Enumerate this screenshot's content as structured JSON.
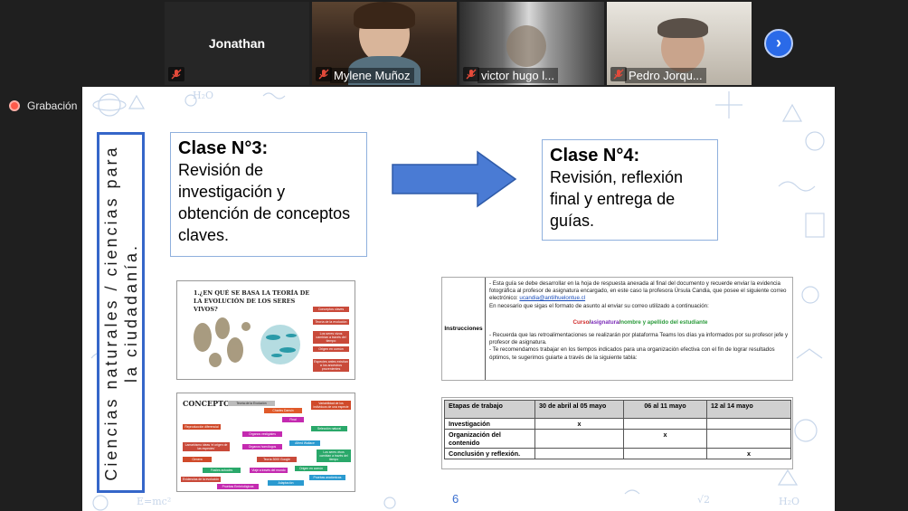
{
  "participants": [
    {
      "name": "Jonathan",
      "muted": true,
      "video": false
    },
    {
      "name": "Mylene Muñoz",
      "muted": true,
      "video": true
    },
    {
      "name": "victor hugo l...",
      "muted": true,
      "video": true
    },
    {
      "name": "Pedro Jorqu...",
      "muted": true,
      "video": true
    }
  ],
  "recording_label": "Grabación",
  "next_button": "›",
  "slide": {
    "vertical_title": "Ciencias naturales / ciencias para la ciudadanía.",
    "clase3_title": "Clase N°3:",
    "clase3_body": "Revisión de investigación y obtención de conceptos claves.",
    "clase4_title": "Clase N°4:",
    "clase4_body": "Revisión, reflexión final y entrega de guías.",
    "page_number": "6",
    "evo_question": "1.¿EN QUÉ SE BASA LA TEORÍA DE LA EVOLUCIÓN DE LOS SERES VIVOS?",
    "evo_tags": [
      "Conceptos claves",
      "Teoría de la evolución",
      "Los seres vivos cambian a través del tiempo",
      "Origen en común",
      "Especies antes existían a los ancestros provenientes"
    ],
    "concepts_title": "CONCEPTOS",
    "concepts": [
      "Teoría de la Evolución",
      "Charles Darwin",
      "Variabilidad de los individuos de una especie",
      "Final",
      "Reproducción diferencial",
      "Selección natural",
      "Organos vestigiales",
      "Lamarkismo ideas 'el origen de las especies'",
      "Organos homólogos",
      "Alfred Wallace",
      "Genera",
      "Teoría 3000 Google",
      "Los seres vivos cambian a través del tiempo",
      "Fósiles actuales",
      "Origen en común",
      "Viaje a través del mundo",
      "Evidencias de la evolución",
      "Pruebas Embriológicas",
      "Adaptación",
      "Pruebas anatómicas"
    ],
    "instructions": {
      "label": "Instrucciones",
      "p1": "Esta guía se debe desarrollar en la hoja de respuesta anexada al final del documento y recuerde enviar la evidencia fotográfica al profesor de asignatura encargado, en este caso la profesora Úrsula Candia, que posee el siguiente correo electrónico:",
      "email": "ucandia@antilhuelontue.cl",
      "p2": "En necesario que sigas el formato de asunto al enviar su correo utilizado a continuación:",
      "format_curso": "Curso",
      "format_asignatura": "asignatura",
      "format_nombre": "nombre y apellido del estudiante",
      "p3": "Recuerda que las retroalimentaciones se realizarán por plataforma Teams los días ya informados por su profesor jefe y profesor de asignatura.",
      "p4": "Te recomendamos trabajar en los tiempos indicados para una organización efectiva con el fin de lograr resultados óptimos, te sugerimos guiarte a través de la siguiente tabla:"
    },
    "stages_table": {
      "headers": [
        "Etapas de trabajo",
        "30 de abril al 05 mayo",
        "06 al 11 mayo",
        "12 al 14 mayo"
      ],
      "rows": [
        [
          "Investigación",
          "x",
          "",
          ""
        ],
        [
          "Organización del contenido",
          "",
          "x",
          ""
        ],
        [
          "Conclusión y reflexión.",
          "",
          "",
          "x"
        ]
      ]
    }
  },
  "colors": {
    "accent": "#3566c9",
    "arrow": "#4a7bd4",
    "record": "#ff5a4a",
    "next": "#2a6ae8"
  }
}
